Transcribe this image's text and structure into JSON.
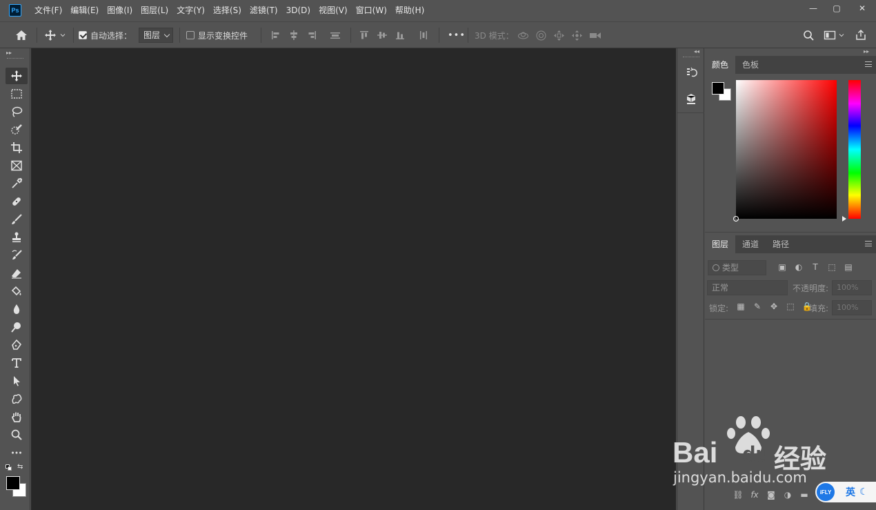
{
  "app": {
    "logo_text": "Ps",
    "menu": [
      "文件(F)",
      "编辑(E)",
      "图像(I)",
      "图层(L)",
      "文字(Y)",
      "选择(S)",
      "滤镜(T)",
      "3D(D)",
      "视图(V)",
      "窗口(W)",
      "帮助(H)"
    ],
    "window_controls": {
      "minimize": "—",
      "maximize": "▢",
      "close": "✕"
    }
  },
  "options_bar": {
    "auto_select_label": "自动选择：",
    "auto_select_checked": true,
    "auto_select_target": "图层",
    "show_transform_label": "显示变换控件",
    "show_transform_checked": false,
    "more": "•••",
    "mode_3d_label": "3D 模式："
  },
  "tools": [
    "move-tool",
    "rectangular-marquee-tool",
    "lasso-tool",
    "quick-selection-tool",
    "crop-tool",
    "frame-tool",
    "eyedropper-tool",
    "healing-brush-tool",
    "brush-tool",
    "clone-stamp-tool",
    "history-brush-tool",
    "eraser-tool",
    "paint-bucket-tool",
    "blur-tool",
    "dodge-tool",
    "pen-tool",
    "type-tool",
    "path-selection-tool",
    "custom-shape-tool",
    "hand-tool",
    "zoom-tool",
    "edit-toolbar"
  ],
  "panels": {
    "color_tabs": [
      "颜色",
      "色板"
    ],
    "color_active_tab": "颜色",
    "foreground_color": "#000000",
    "background_color": "#ffffff",
    "layers_tabs": [
      "图层",
      "通道",
      "路径"
    ],
    "layers_active_tab": "图层",
    "filter_kind_placeholder": "类型",
    "blend_mode": "正常",
    "opacity_label": "不透明度:",
    "opacity_value": "100%",
    "lock_label": "锁定:",
    "fill_label": "填充:",
    "fill_value": "100%"
  },
  "watermark": {
    "brand_left": "Bai",
    "brand_mid": "du",
    "brand_right": "经验",
    "url": "jingyan.baidu.com"
  },
  "ime": {
    "logo": "iFLY",
    "lang": "英"
  }
}
